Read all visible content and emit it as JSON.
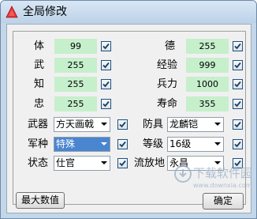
{
  "window": {
    "title": "全局修改"
  },
  "stats_left": [
    {
      "label": "体",
      "value": "99",
      "checked": true
    },
    {
      "label": "武",
      "value": "255",
      "checked": true
    },
    {
      "label": "知",
      "value": "255",
      "checked": true
    },
    {
      "label": "忠",
      "value": "255",
      "checked": true
    }
  ],
  "stats_right": [
    {
      "label": "德",
      "value": "255",
      "checked": true
    },
    {
      "label": "经验",
      "value": "999",
      "checked": true
    },
    {
      "label": "兵力",
      "value": "1000",
      "checked": true
    },
    {
      "label": "寿命",
      "value": "355",
      "checked": true
    }
  ],
  "selects_left": [
    {
      "label": "武器",
      "value": "方天画戟",
      "checked": true
    },
    {
      "label": "军种",
      "value": "特殊",
      "checked": true
    },
    {
      "label": "状态",
      "value": "仕官",
      "checked": true
    }
  ],
  "selects_right": [
    {
      "label": "防具",
      "value": "龙麟铠",
      "checked": true
    },
    {
      "label": "等级",
      "value": "16级",
      "checked": true
    },
    {
      "label": "流放地",
      "value": "永昌",
      "checked": true
    }
  ],
  "buttons": {
    "max_values": "最大数值",
    "ok": "确定"
  },
  "watermark": {
    "line1": "下载软件园",
    "line2": "www.downxia.com"
  }
}
